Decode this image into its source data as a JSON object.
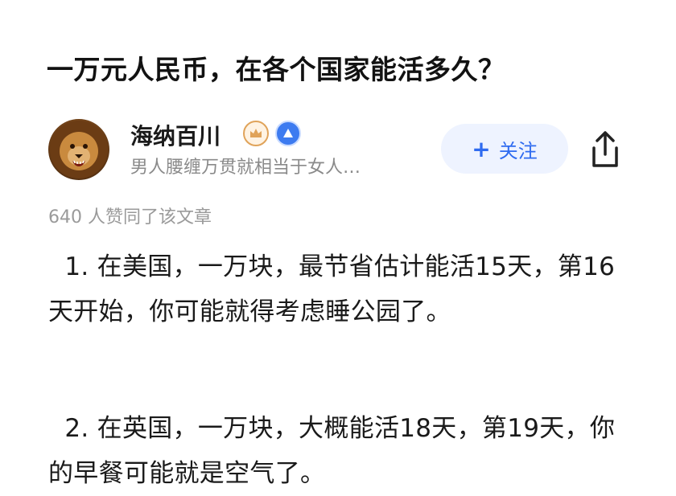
{
  "question": {
    "title": "一万元人民币，在各个国家能活多久？"
  },
  "author": {
    "name": "海纳百川",
    "bio": "男人腰缠万贯就相当于女人…",
    "avatar_icon": "lion-avatar",
    "badges": [
      "crown-badge-icon",
      "level-badge-icon"
    ]
  },
  "actions": {
    "follow_label": "关注",
    "follow_icon": "plus-icon",
    "share_icon": "share-icon",
    "accent_color": "#2f6bf0"
  },
  "stats": {
    "approval_text": "640 人赞同了该文章"
  },
  "content": {
    "paragraphs": [
      "  1. 在美国，一万块，最节省估计能活15天，第16天开始，你可能就得考虑睡公园了。",
      "  2. 在英国，一万块，大概能活18天，第19天，你的早餐可能就是空气了。"
    ]
  }
}
